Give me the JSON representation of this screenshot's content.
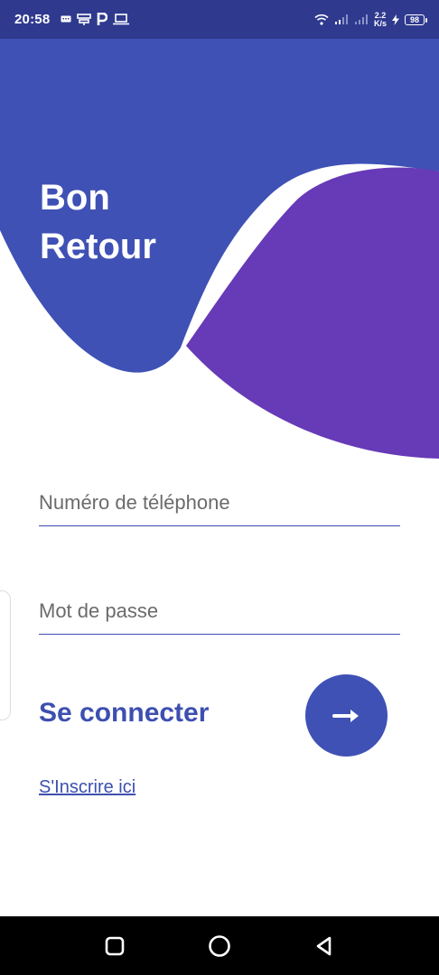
{
  "status_bar": {
    "time": "20:58",
    "net_speed_value": "2.2",
    "net_speed_unit": "K/s",
    "battery_level": "98"
  },
  "hero": {
    "title_line1": "Bon",
    "title_line2": "Retour",
    "colors": {
      "primary": "#3f51b5",
      "secondary": "#673ab7"
    }
  },
  "form": {
    "phone_placeholder": "Numéro de téléphone",
    "password_placeholder": "Mot de passe"
  },
  "signin": {
    "label": "Se connecter"
  },
  "signup": {
    "link_text": "S'Inscrire ici"
  },
  "nav_bar": {
    "buttons": [
      "recent-apps-icon",
      "home-icon",
      "back-icon"
    ]
  }
}
